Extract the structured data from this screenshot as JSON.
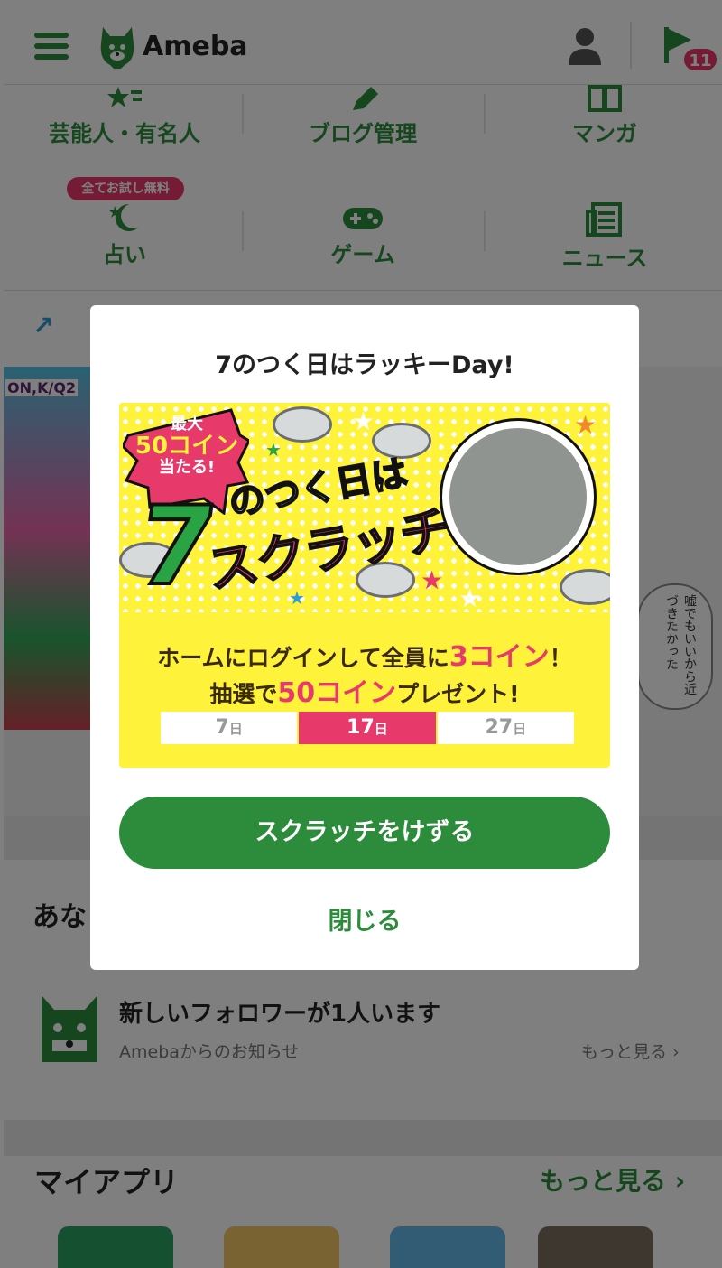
{
  "header": {
    "logo_text": "Ameba",
    "notification_count": "11",
    "brand_color": "#2d8c3c"
  },
  "menu": {
    "items": [
      {
        "label": "芸能人・有名人",
        "icon": "star-icon"
      },
      {
        "label": "ブログ管理",
        "icon": "pen-icon"
      },
      {
        "label": "マンガ",
        "icon": "book-icon"
      },
      {
        "label": "占い",
        "icon": "moon-icon"
      },
      {
        "label": "ゲーム",
        "icon": "gamepad-icon"
      },
      {
        "label": "ニュース",
        "icon": "newspaper-icon"
      }
    ],
    "trial_tag": "全てお試し無料"
  },
  "banner": {
    "left_caption": "ON,K/Q2",
    "right_bubble_text": "嘘でもいいから近づきたかった"
  },
  "notice": {
    "heading": "あな",
    "title": "新しいフォロワーが1人います",
    "subtitle": "Amebaからのお知らせ",
    "more": "もっと見る"
  },
  "apps": {
    "heading": "マイアプリ",
    "more": "もっと見る",
    "tile_colors": [
      "#2aa160",
      "#f3c766",
      "#65b9e6",
      "#7b6f60"
    ]
  },
  "modal": {
    "title": "7のつく日はラッキーDay!",
    "promo": {
      "burst_line1": "最大",
      "burst_line2": "50コイン",
      "burst_line3": "当たる!",
      "big_digit": "7",
      "headline_small": "のつく日は",
      "headline_big": "スクラッチ",
      "line1_pre": "ホームにログインして全員に",
      "line1_hl": "3コイン",
      "line1_post": "！",
      "line2_pre": "抽選で",
      "line2_hl": "50コイン",
      "line2_post": "プレゼント!",
      "days": [
        {
          "num": "7",
          "suffix": "日",
          "active": false
        },
        {
          "num": "17",
          "suffix": "日",
          "active": true
        },
        {
          "num": "27",
          "suffix": "日",
          "active": false
        }
      ],
      "accent_pink": "#e8396b",
      "accent_yellow": "#fff23a"
    },
    "primary_button": "スクラッチをけずる",
    "close_label": "閉じる"
  }
}
